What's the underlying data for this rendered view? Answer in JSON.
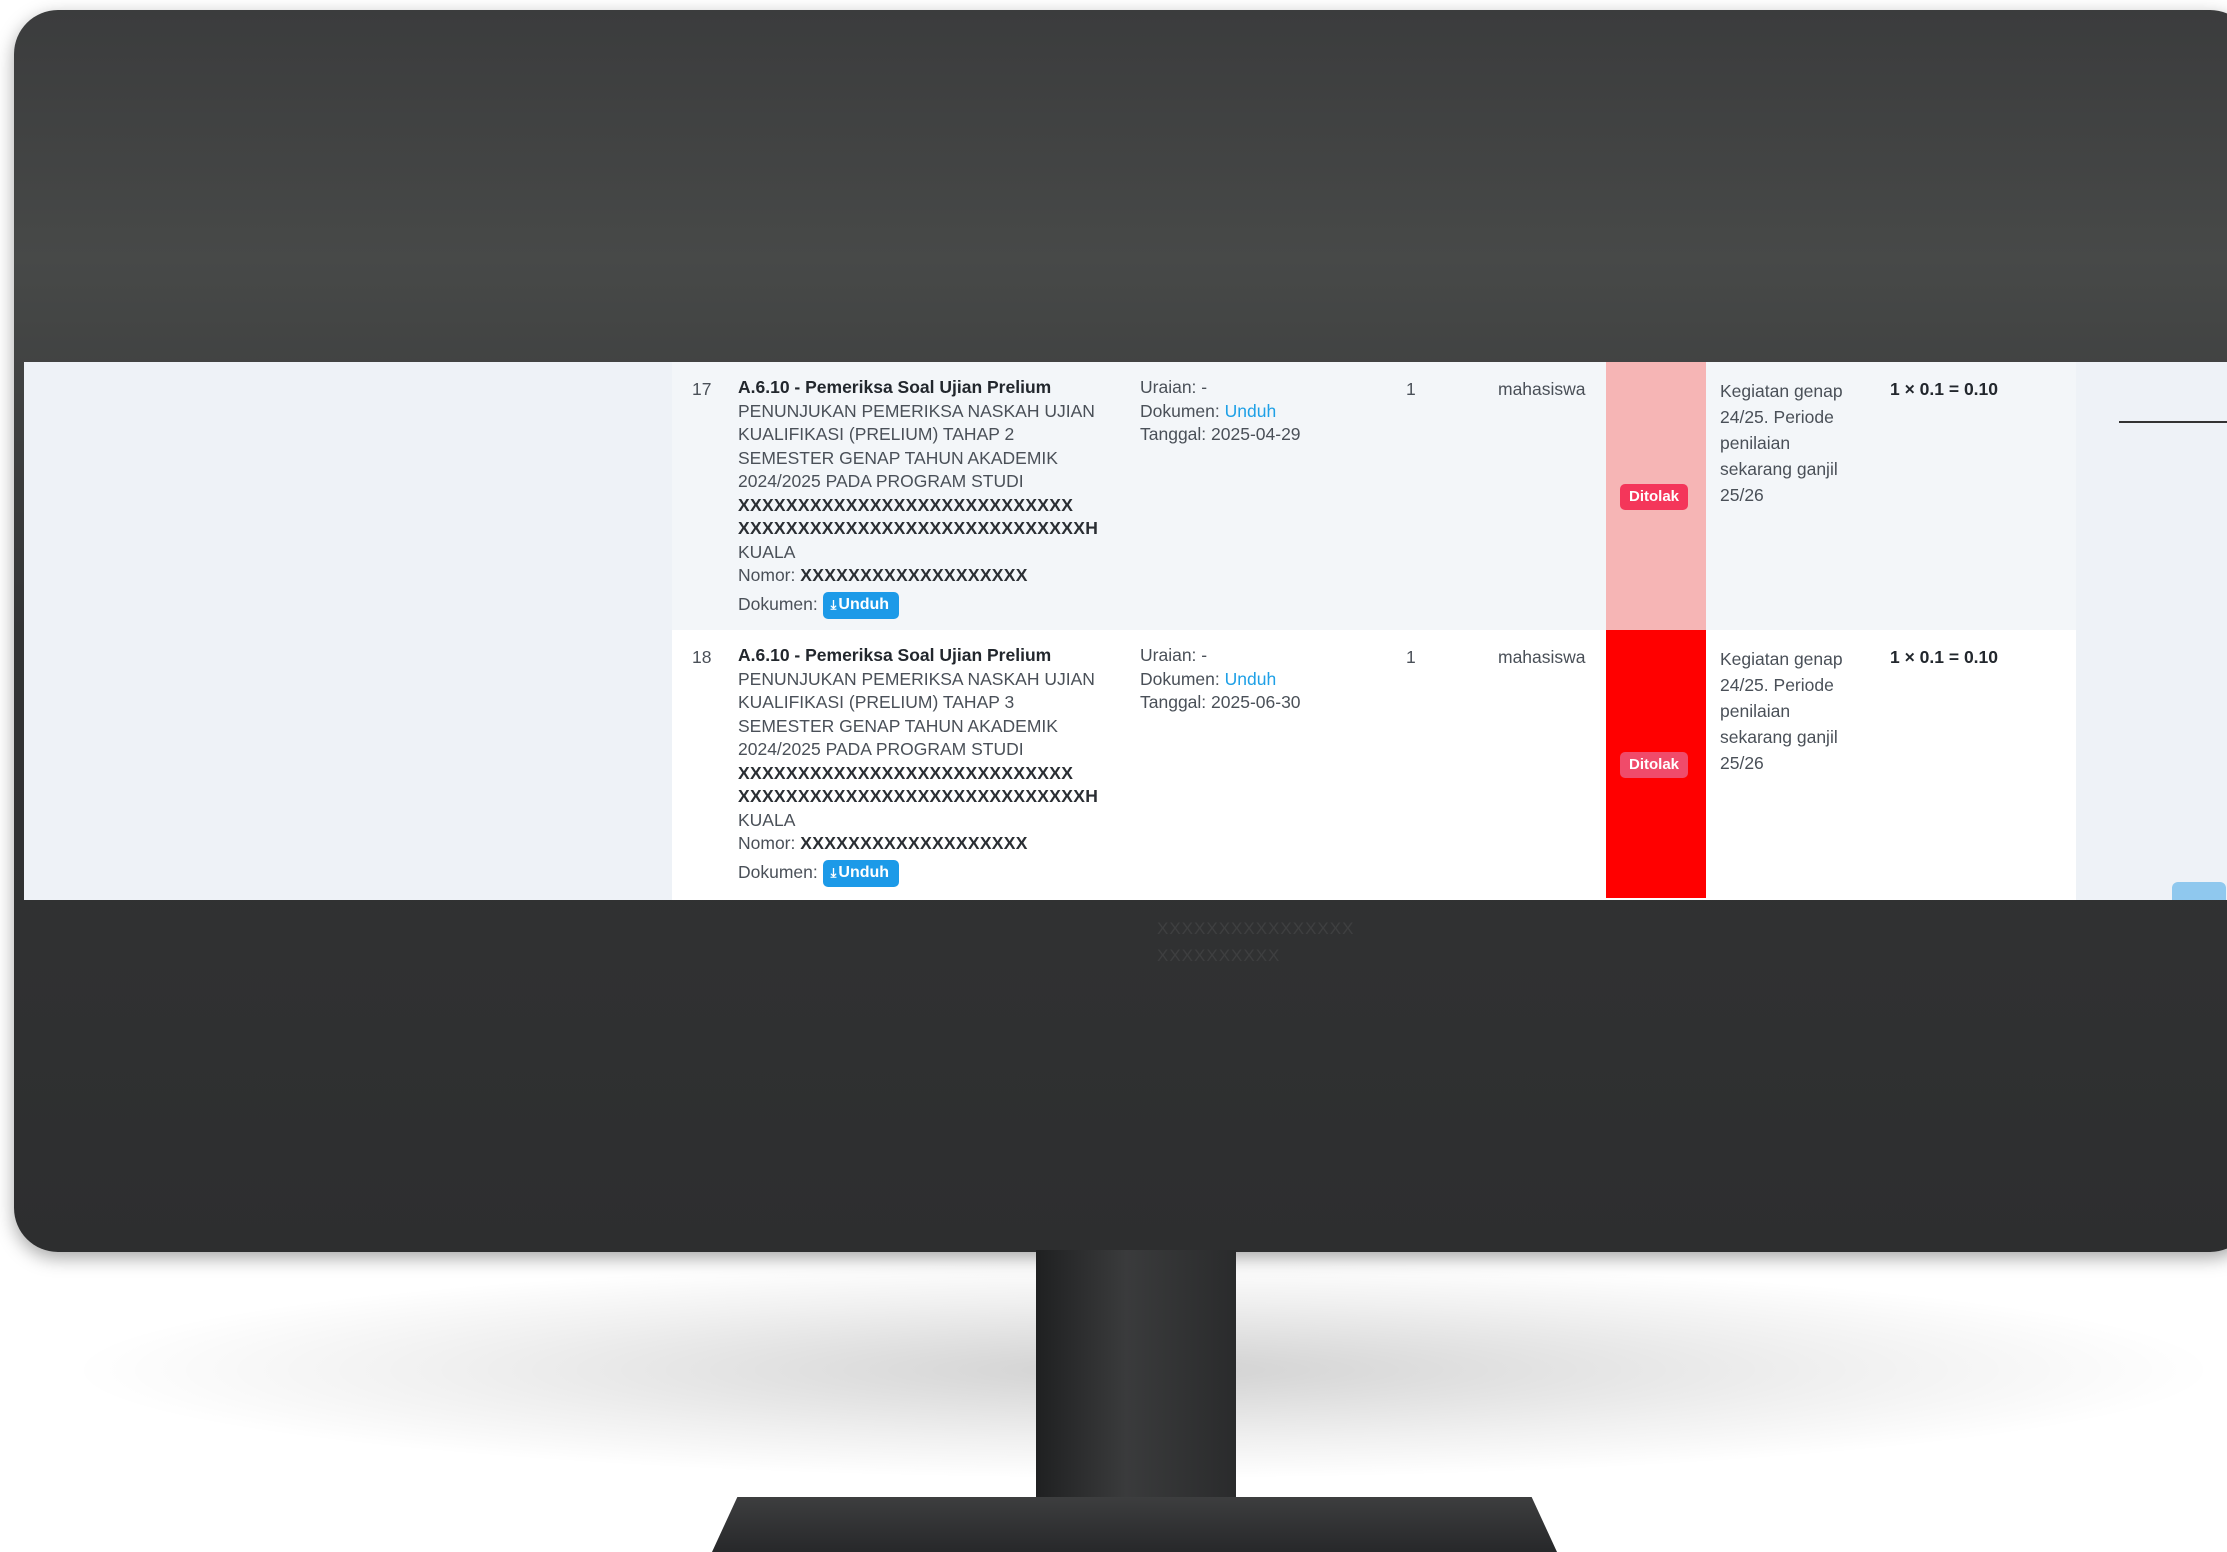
{
  "rows": [
    {
      "no": "17",
      "kegiatan": {
        "title": "A.6.10 - Pemeriksa Soal Ujian Prelium",
        "lines": [
          "PENUNJUKAN PEMERIKSA NASKAH UJIAN",
          "KUALIFIKASI (PRELIUM) TAHAP 2",
          "SEMESTER GENAP TAHUN AKADEMIK",
          "2024/2025 PADA PROGRAM STUDI"
        ],
        "mask1": "XXXXXXXXXXXXXXXXXXXXXXXXXXXX",
        "mask2": "XXXXXXXXXXXXXXXXXXXXXXXXXXXXXH",
        "line_end": "KUALA",
        "nomor_label": "Nomor:",
        "nomor_value": "XXXXXXXXXXXXXXXXXXX",
        "dokumen_label": "Dokumen:",
        "download_button": "Unduh"
      },
      "uraian": "Uraian: -",
      "dokumen_label": "Dokumen:",
      "dokumen_link": "Unduh",
      "tanggal": "Tanggal: 2025-04-29",
      "qty": "1",
      "role": "mahasiswa",
      "status": "Ditolak",
      "note": [
        "Kegiatan genap",
        "24/25. Periode",
        "penilaian",
        "sekarang ganjil",
        "25/26"
      ],
      "score": "1 × 0.1 = 0.10"
    },
    {
      "no": "18",
      "kegiatan": {
        "title": "A.6.10 - Pemeriksa Soal Ujian Prelium",
        "lines": [
          "PENUNJUKAN PEMERIKSA NASKAH UJIAN",
          "KUALIFIKASI (PRELIUM) TAHAP 3",
          "SEMESTER GENAP TAHUN AKADEMIK",
          "2024/2025 PADA PROGRAM STUDI"
        ],
        "mask1": "XXXXXXXXXXXXXXXXXXXXXXXXXXXX",
        "mask2": "XXXXXXXXXXXXXXXXXXXXXXXXXXXXXH",
        "line_end": "KUALA",
        "nomor_label": "Nomor:",
        "nomor_value": "XXXXXXXXXXXXXXXXXXX",
        "dokumen_label": "Dokumen:",
        "download_button": "Unduh"
      },
      "uraian": "Uraian: -",
      "dokumen_label": "Dokumen:",
      "dokumen_link": "Unduh",
      "tanggal": "Tanggal: 2025-06-30",
      "qty": "1",
      "role": "mahasiswa",
      "status": "Ditolak",
      "note": [
        "Kegiatan genap",
        "24/25. Periode",
        "penilaian",
        "sekarang ganjil",
        "25/26"
      ],
      "score": "1 × 0.1 = 0.10"
    }
  ],
  "faint_text": [
    "XXXXXXXXXXXXXXXX",
    "XXXXXXXXXX"
  ],
  "colors": {
    "status_17_bg": "#f6b5b5",
    "status_18_bg": "#ff0000",
    "badge": "#f4365a",
    "link": "#1ea0e6",
    "button": "#1c9ae8"
  },
  "icons": {
    "download": "download-icon"
  }
}
